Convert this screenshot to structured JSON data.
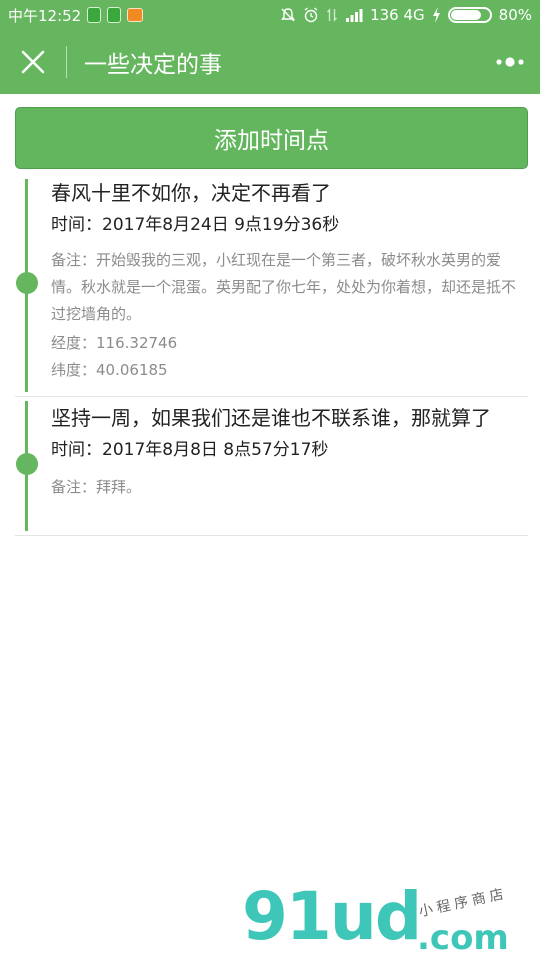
{
  "statusbar": {
    "time": "中午12:52",
    "network": "136 4G",
    "battery": "80%",
    "battery_level": 0.8
  },
  "navbar": {
    "title": "一些决定的事"
  },
  "add_button": {
    "label": "添加时间点"
  },
  "entries": [
    {
      "title": "春风十里不如你，决定不再看了",
      "time": "时间：2017年8月24日 9点19分36秒",
      "note": "备注：开始毁我的三观，小红现在是一个第三者，破坏秋水英男的爱情。秋水就是一个混蛋。英男配了你七年，处处为你着想，却还是抵不过挖墙角的。",
      "longitude": "经度：116.32746",
      "latitude": "纬度：40.06185"
    },
    {
      "title": "坚持一周，如果我们还是谁也不联系谁，那就算了",
      "time": "时间：2017年8月8日 8点57分17秒",
      "note": "备注：拜拜。"
    }
  ],
  "watermark": {
    "brand": "91ud",
    "domain": ".com",
    "tagline": "小程序商店"
  },
  "colors": {
    "accent": "#65b65e"
  }
}
